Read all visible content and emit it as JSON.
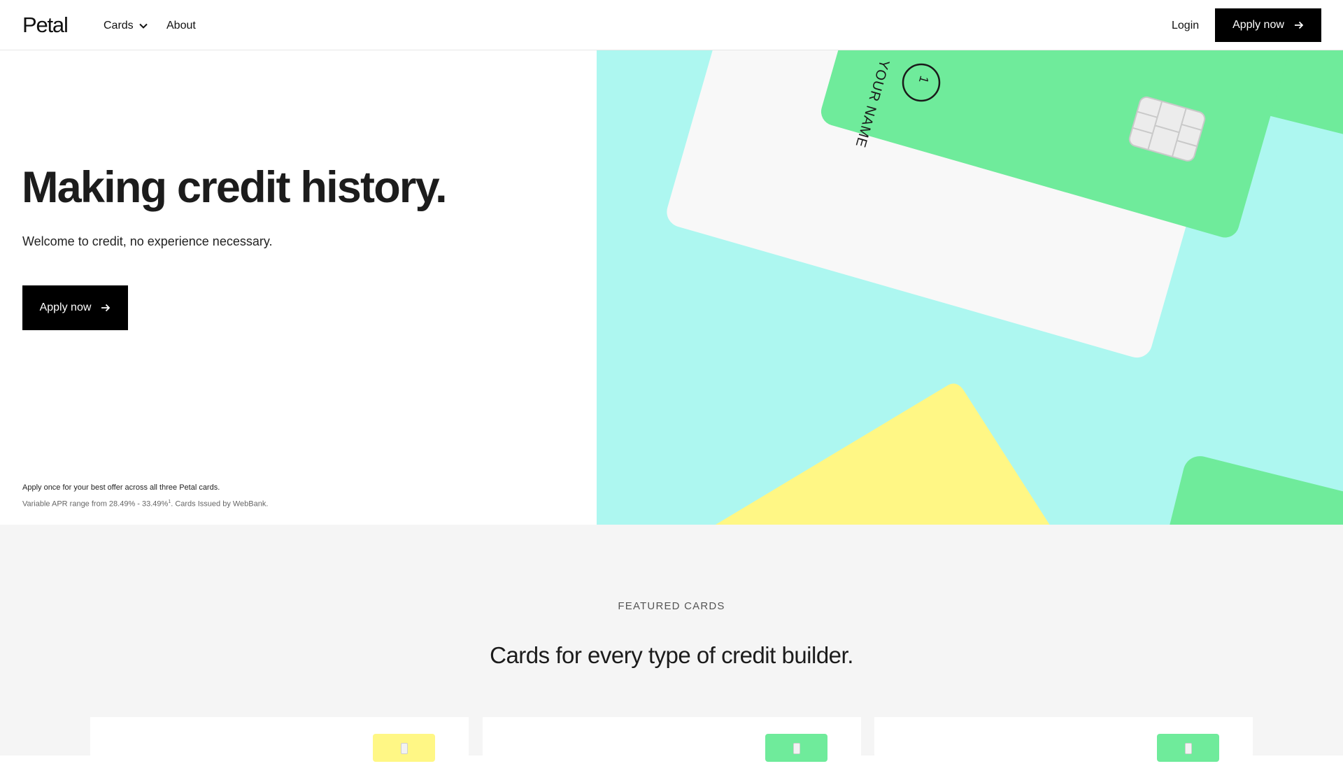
{
  "nav": {
    "logo": "Petal",
    "cards_label": "Cards",
    "about_label": "About",
    "login_label": "Login",
    "apply_label": "Apply now"
  },
  "hero": {
    "title": "Making credit history.",
    "subtitle": "Welcome to credit, no experience necessary.",
    "apply_label": "Apply now",
    "disclaimer_1": "Apply once for your best offer across all three Petal cards.",
    "disclaimer_2": "Variable APR range from 28.49% - 33.49%",
    "disclaimer_2_sup": "1",
    "disclaimer_2_end": ". Cards Issued by WebBank.",
    "card_name": "YOUR NAME",
    "card_badge": "1"
  },
  "featured": {
    "eyebrow": "FEATURED CARDS",
    "title": "Cards for every type of credit builder."
  },
  "colors": {
    "hero_bg": "#adf7f0",
    "green_card": "#6feb9b",
    "yellow_card": "#fff785",
    "white_card": "#f8f8f8",
    "section_bg": "#f5f5f5"
  },
  "icons": [
    "chevron-down-icon",
    "arrow-right-icon",
    "chip-icon"
  ]
}
